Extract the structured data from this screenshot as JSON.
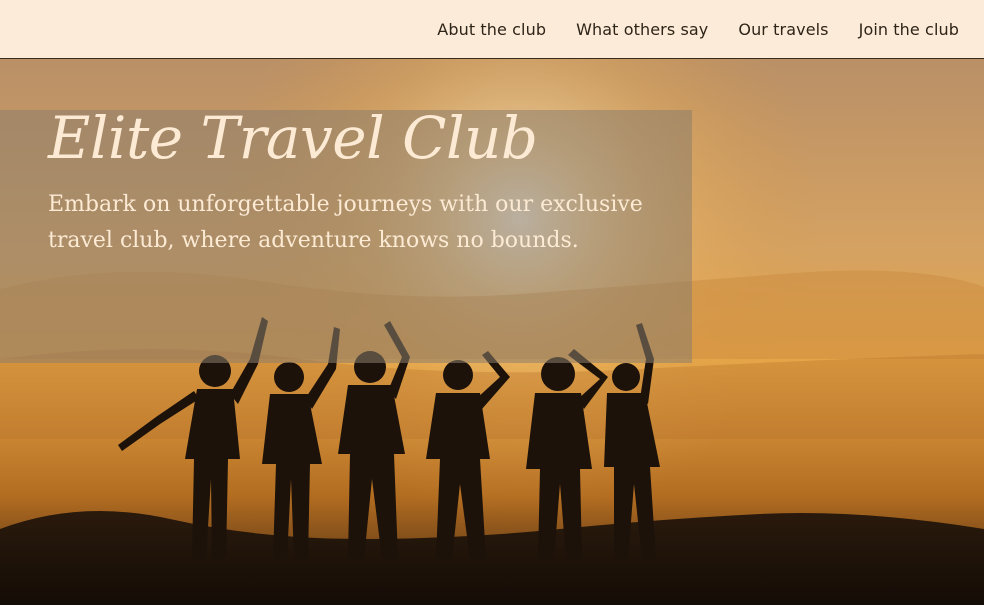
{
  "nav": {
    "items": [
      {
        "label": "Abut the club"
      },
      {
        "label": "What others say"
      },
      {
        "label": "Our travels"
      },
      {
        "label": "Join the club"
      }
    ]
  },
  "hero": {
    "title": "Elite Travel Club",
    "tagline": "Embark on unforgettable journeys with our exclusive travel club, where adventure knows no bounds.",
    "colors": {
      "nav_background": "#fbebd8",
      "text_light": "#fcead4",
      "sky_glow": "#e5a548"
    }
  }
}
